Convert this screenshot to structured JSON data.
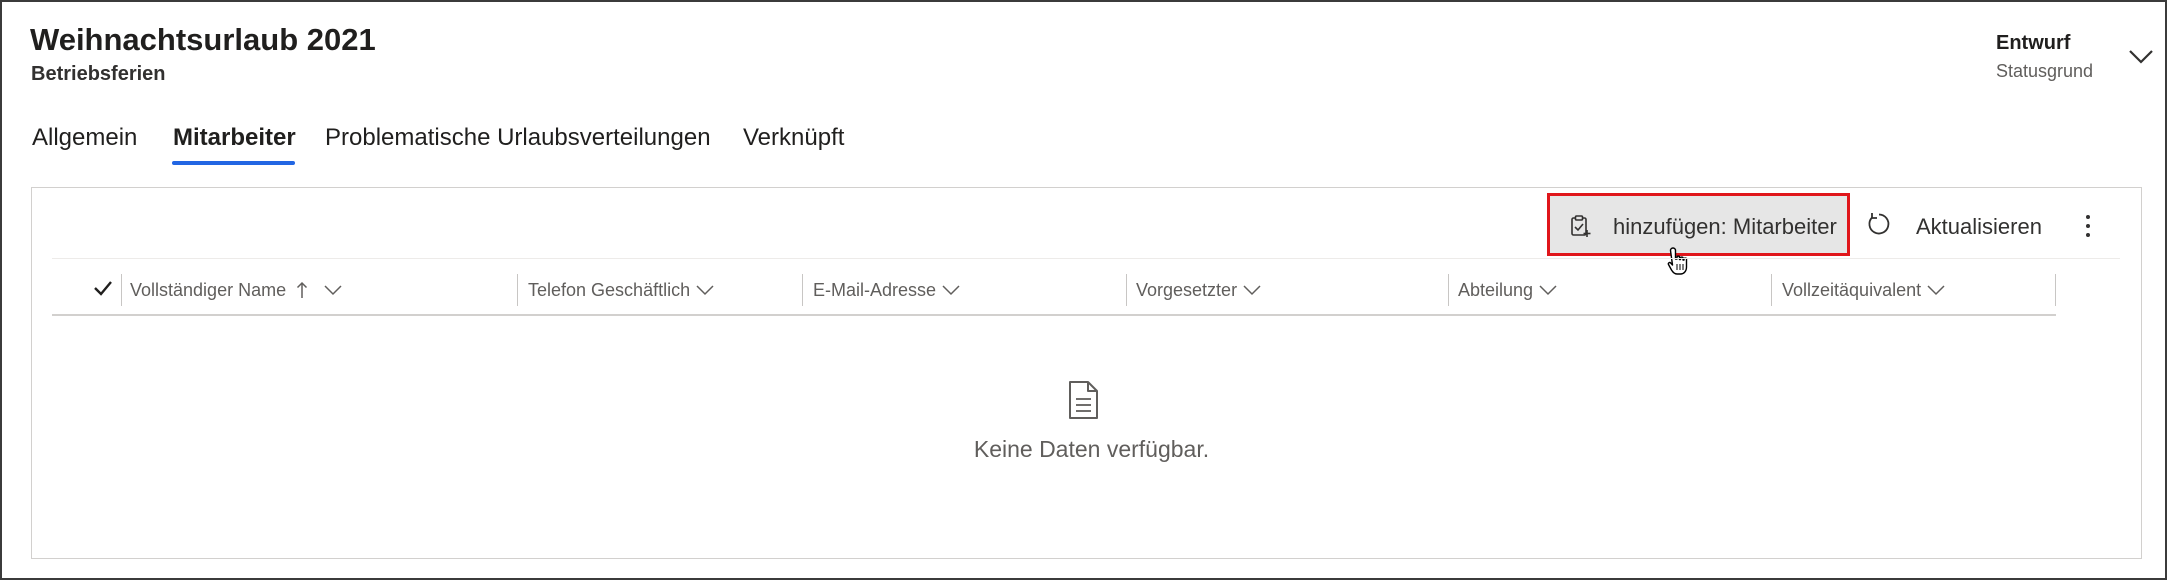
{
  "header": {
    "title": "Weihnachtsurlaub 2021",
    "subtitle": "Betriebsferien",
    "status_value": "Entwurf",
    "status_label": "Statusgrund"
  },
  "tabs": [
    {
      "label": "Allgemein",
      "active": false
    },
    {
      "label": "Mitarbeiter",
      "active": true
    },
    {
      "label": "Problematische Urlaubsverteilungen",
      "active": false
    },
    {
      "label": "Verknüpft",
      "active": false
    }
  ],
  "commands": {
    "add_label": "hinzufügen: Mitarbeiter",
    "refresh_label": "Aktualisieren",
    "add_icon": "clipboard-add-icon",
    "refresh_icon": "refresh-icon",
    "more_icon": "more-vertical-icon"
  },
  "columns": [
    {
      "label": "Vollständiger Name",
      "sorted": "ascending"
    },
    {
      "label": "Telefon Geschäftlich"
    },
    {
      "label": "E-Mail-Adresse"
    },
    {
      "label": "Vorgesetzter"
    },
    {
      "label": "Abteilung"
    },
    {
      "label": "Vollzeitäquivalent"
    }
  ],
  "empty_state": {
    "icon": "document-icon",
    "message": "Keine Daten verfügbar."
  },
  "colors": {
    "accent": "#2266e3",
    "highlight_border": "#e0161b",
    "button_bg": "#e6e6e6"
  }
}
